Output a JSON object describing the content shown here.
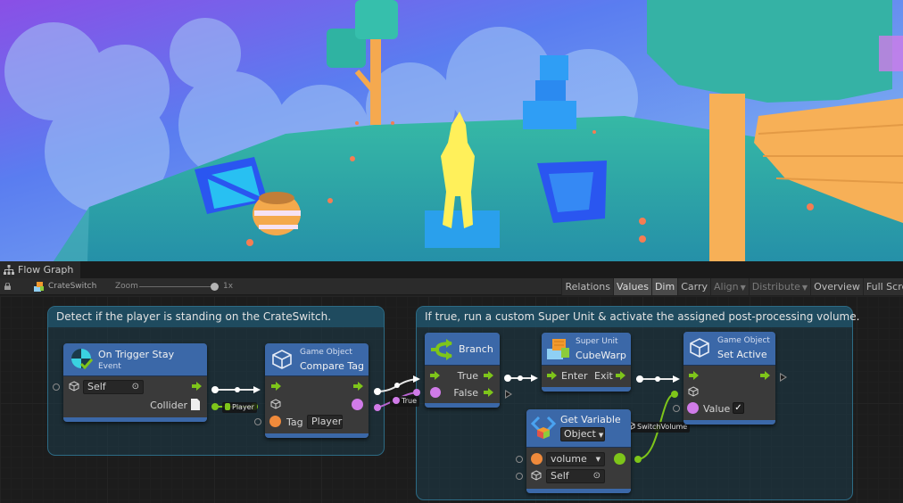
{
  "window": {
    "tab_title": "Flow Graph"
  },
  "toolbar": {
    "graph_name": "CrateSwitch",
    "zoom_label": "Zoom",
    "zoom_value": "1x",
    "zoom_level": 1.0,
    "buttons": [
      {
        "label": "Relations",
        "state": "normal",
        "has_dropdown": false
      },
      {
        "label": "Values",
        "state": "on",
        "has_dropdown": false
      },
      {
        "label": "Dim",
        "state": "on",
        "has_dropdown": false
      },
      {
        "label": "Carry",
        "state": "normal",
        "has_dropdown": false
      },
      {
        "label": "Align",
        "state": "disabled",
        "has_dropdown": true
      },
      {
        "label": "Distribute",
        "state": "disabled",
        "has_dropdown": true
      },
      {
        "label": "Overview",
        "state": "normal",
        "has_dropdown": false
      },
      {
        "label": "Full Screen",
        "state": "normal",
        "has_dropdown": false
      }
    ]
  },
  "groups": [
    {
      "label": "Detect if the player is standing on the CrateSwitch."
    },
    {
      "label": "If true, run a custom Super Unit & activate the assigned post-processing volume."
    }
  ],
  "nodes": {
    "on_trigger_stay": {
      "title": "On Trigger Stay",
      "subtitle": "Event",
      "target_value": "Self",
      "output_label": "Collider"
    },
    "compare_tag": {
      "subtitle": "Game Object",
      "title": "Compare Tag",
      "tag_label": "Tag",
      "tag_value": "Player"
    },
    "branch": {
      "title": "Branch",
      "true_label": "True",
      "false_label": "False"
    },
    "cube_warp": {
      "subtitle": "Super Unit",
      "title": "CubeWarp",
      "enter_label": "Enter",
      "exit_label": "Exit"
    },
    "set_active": {
      "subtitle": "Game Object",
      "title": "Set Active",
      "value_label": "Value",
      "value_checked": true
    },
    "get_variable": {
      "title": "Get Variable",
      "kind_value": "Object",
      "name_value": "volume",
      "target_value": "Self"
    }
  },
  "wire_chips": {
    "player": "Player",
    "true": "True",
    "switch_volume": "SwitchVolume"
  },
  "colors": {
    "node_header": "#3b68a8",
    "control_flow": "#7ec51a",
    "value_pink": "#d07be8",
    "value_orange": "#f08a3b",
    "value_green": "#7ec51a",
    "group_border": "#2d6b85"
  }
}
